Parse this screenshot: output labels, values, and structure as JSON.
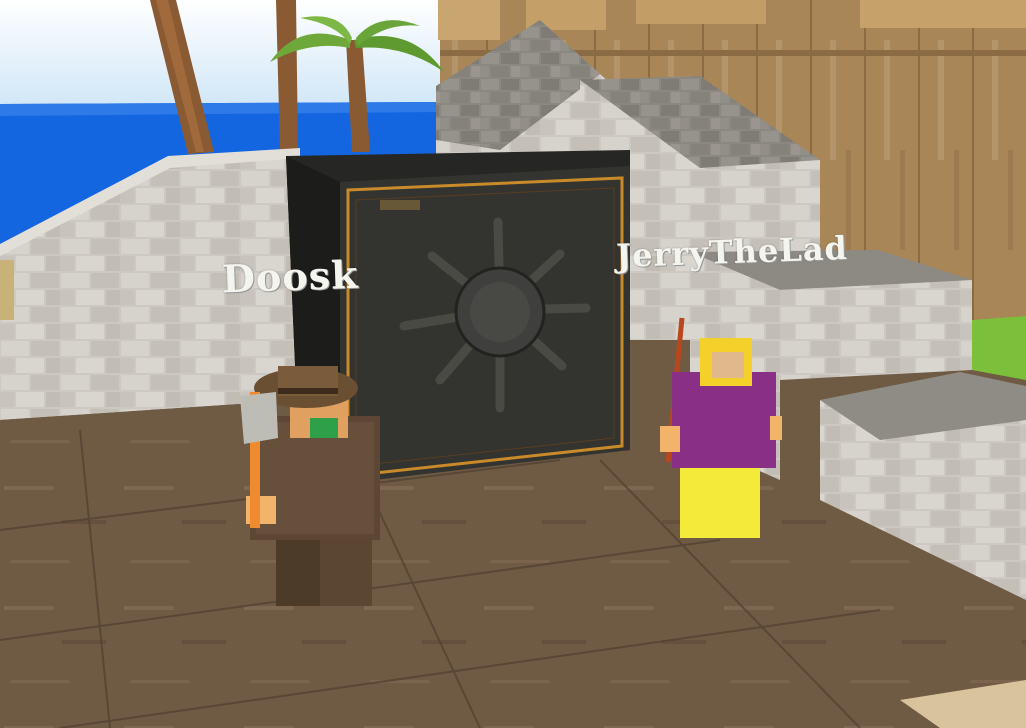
{
  "players": [
    {
      "name": "Doosk"
    },
    {
      "name": "JerryTheLad"
    }
  ],
  "colors": {
    "sky": "#cfe6f7",
    "ocean": "#1466e0",
    "stone": "#c9c5be",
    "safe": "#2f2f2c",
    "safe_trim": "#c98a2a",
    "floor": "#6f5a44",
    "wood_wall": "#a88658",
    "jerry_shirt": "#8a2f86",
    "jerry_legs": "#f3ea3a",
    "jerry_hair": "#f4d12a"
  },
  "icons": [
    "safe-icon",
    "palm-tree-icon",
    "axe-icon",
    "fishing-rod-icon"
  ]
}
